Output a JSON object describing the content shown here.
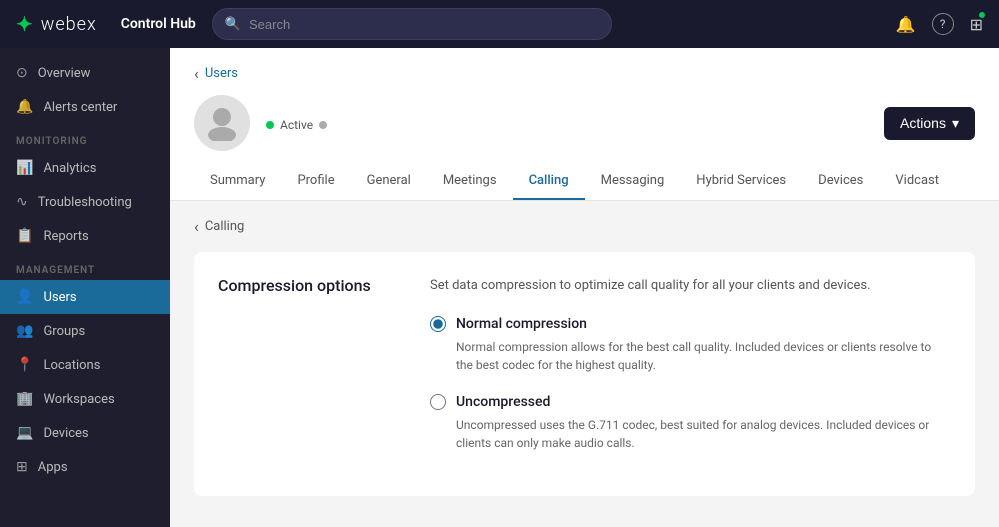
{
  "app": {
    "logo": "webex",
    "brand": "Control Hub",
    "search_placeholder": "Search"
  },
  "nav_icons": {
    "bell": "🔔",
    "help": "?",
    "apps": "⊞"
  },
  "sidebar": {
    "monitoring_label": "MONITORING",
    "management_label": "MANAGEMENT",
    "items_top": [
      {
        "id": "overview",
        "label": "Overview",
        "icon": "⊙"
      },
      {
        "id": "alerts",
        "label": "Alerts center",
        "icon": "🔔"
      }
    ],
    "items_monitoring": [
      {
        "id": "analytics",
        "label": "Analytics",
        "icon": "📊"
      },
      {
        "id": "troubleshooting",
        "label": "Troubleshooting",
        "icon": "∿"
      },
      {
        "id": "reports",
        "label": "Reports",
        "icon": "📋"
      }
    ],
    "items_management": [
      {
        "id": "users",
        "label": "Users",
        "icon": "👤",
        "active": true
      },
      {
        "id": "groups",
        "label": "Groups",
        "icon": "👥"
      },
      {
        "id": "locations",
        "label": "Locations",
        "icon": "📍"
      },
      {
        "id": "workspaces",
        "label": "Workspaces",
        "icon": "🏢"
      },
      {
        "id": "devices",
        "label": "Devices",
        "icon": "💻"
      },
      {
        "id": "apps",
        "label": "Apps",
        "icon": "⊞"
      }
    ]
  },
  "breadcrumb": {
    "back_icon": "‹",
    "label": "Users"
  },
  "user": {
    "status": "Active",
    "actions_label": "Actions",
    "actions_icon": "▾"
  },
  "tabs": [
    {
      "id": "summary",
      "label": "Summary"
    },
    {
      "id": "profile",
      "label": "Profile"
    },
    {
      "id": "general",
      "label": "General"
    },
    {
      "id": "meetings",
      "label": "Meetings"
    },
    {
      "id": "calling",
      "label": "Calling",
      "active": true
    },
    {
      "id": "messaging",
      "label": "Messaging"
    },
    {
      "id": "hybrid",
      "label": "Hybrid Services"
    },
    {
      "id": "devices",
      "label": "Devices"
    },
    {
      "id": "vidcast",
      "label": "Vidcast"
    }
  ],
  "calling_page": {
    "breadcrumb_icon": "‹",
    "breadcrumb_label": "Calling",
    "section_title": "Compression options",
    "section_desc": "Set data compression to optimize call quality for all your clients and devices.",
    "options": [
      {
        "id": "normal",
        "label": "Normal compression",
        "checked": true,
        "description": "Normal compression allows for the best call quality. Included devices or clients resolve to the best codec for the highest quality."
      },
      {
        "id": "uncompressed",
        "label": "Uncompressed",
        "checked": false,
        "description": "Uncompressed uses the G.711 codec, best suited for analog devices. Included devices or clients can only make audio calls."
      }
    ]
  }
}
